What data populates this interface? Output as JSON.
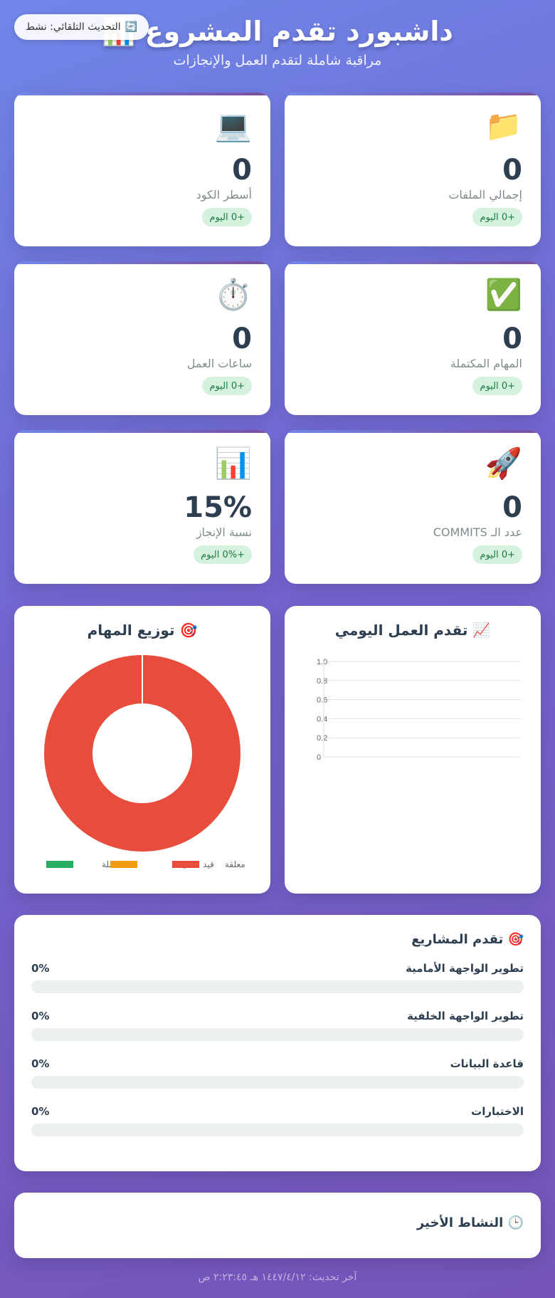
{
  "header": {
    "title": "داشبورد تقدم المشروع 📊",
    "subtitle": "مراقبة شاملة لتقدم العمل والإنجازات"
  },
  "auto_refresh": {
    "icon": "🔄",
    "label": "التحديث التلقائي: نشط"
  },
  "stats": [
    {
      "id": "files",
      "icon": "📁",
      "icon_name": "folder-icon",
      "value": "0",
      "label": "إجمالي الملفات",
      "change": "+0 اليوم"
    },
    {
      "id": "code-lines",
      "icon": "💻",
      "icon_name": "laptop-icon",
      "value": "0",
      "label": "أسطر الكود",
      "change": "+0 اليوم"
    },
    {
      "id": "tasks",
      "icon": "✅",
      "icon_name": "check-icon",
      "value": "0",
      "label": "المهام المكتملة",
      "change": "+0 اليوم"
    },
    {
      "id": "hours",
      "icon": "⏱️",
      "icon_name": "stopwatch-icon",
      "value": "0",
      "label": "ساعات العمل",
      "change": "+0 اليوم"
    },
    {
      "id": "commits",
      "icon": "🚀",
      "icon_name": "rocket-icon",
      "value": "0",
      "label": "عدد الـ COMMITS",
      "change": "+0 اليوم"
    },
    {
      "id": "completion",
      "icon": "📊",
      "icon_name": "bar-chart-icon",
      "value": "15%",
      "label": "نسبة الإنجاز",
      "change": "+0% اليوم"
    }
  ],
  "chart_data": [
    {
      "type": "line",
      "title": "📈 تقدم العمل اليومي",
      "x": [],
      "series": [],
      "ylim": [
        0,
        1
      ],
      "yticks": [
        "0",
        "0.2",
        "0.4",
        "0.6",
        "0.8",
        "1.0"
      ],
      "grid": true
    },
    {
      "type": "pie",
      "title": "🎯 توزيع المهام",
      "labels": [
        "مكتملة",
        "قيد التنفيذ",
        "معلقة"
      ],
      "values": [
        0,
        0,
        1
      ],
      "colors": [
        "#27ae60",
        "#f39c12",
        "#e74c3c"
      ],
      "legend": "bottom"
    }
  ],
  "projects": {
    "title": "🎯 تقدم المشاريع",
    "items": [
      {
        "name": "تطوير الواجهة الأمامية",
        "percent": "0%",
        "value": 0
      },
      {
        "name": "تطوير الواجهة الخلفية",
        "percent": "0%",
        "value": 0
      },
      {
        "name": "قاعدة البيانات",
        "percent": "0%",
        "value": 0
      },
      {
        "name": "الاختبارات",
        "percent": "0%",
        "value": 0
      }
    ]
  },
  "activity": {
    "title": "🕒 النشاط الأخير"
  },
  "footer": {
    "last_update": "آخر تحديث: ١٤٤٧/٤/١٢ هـ ٢:٢٣:٤٥ ص"
  }
}
